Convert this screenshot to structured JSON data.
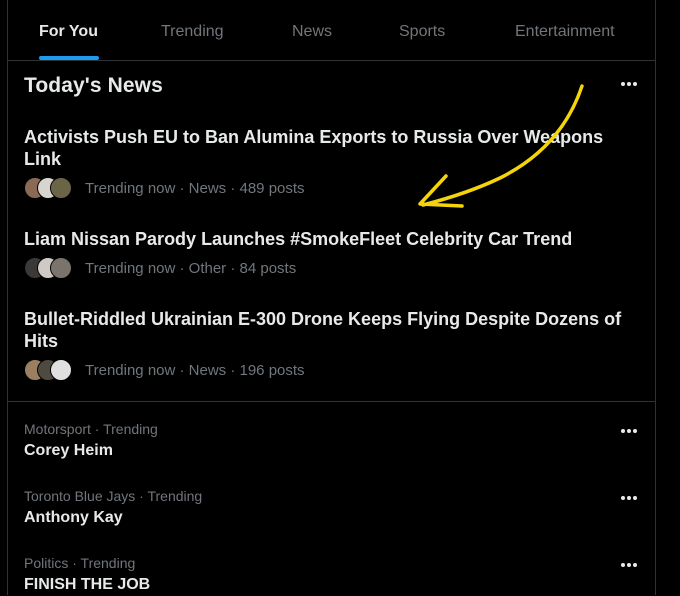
{
  "tabs": [
    {
      "label": "For You",
      "active": true
    },
    {
      "label": "Trending",
      "active": false
    },
    {
      "label": "News",
      "active": false
    },
    {
      "label": "Sports",
      "active": false
    },
    {
      "label": "Entertainment",
      "active": false
    }
  ],
  "section": {
    "title": "Today's News"
  },
  "news": [
    {
      "headline": "Activists Push EU to Ban Alumina Exports to Russia Over Weapons Link",
      "meta": "Trending now · News · 489 posts",
      "avatar_colors": [
        "#8a6a55",
        "#d8d4cf",
        "#6b6548"
      ]
    },
    {
      "headline": "Liam Nissan Parody Launches #SmokeFleet Celebrity Car Trend",
      "meta": "Trending now · Other · 84 posts",
      "avatar_colors": [
        "#3b3838",
        "#cfcac6",
        "#7a746c"
      ]
    },
    {
      "headline": "Bullet-Riddled Ukrainian E-300 Drone Keeps Flying Despite Dozens of Hits",
      "meta": "Trending now · News · 196 posts",
      "avatar_colors": [
        "#9a8060",
        "#4f4a40",
        "#e0e0e0"
      ]
    }
  ],
  "trends": [
    {
      "context": "Motorsport · Trending",
      "name": "Corey Heim"
    },
    {
      "context": "Toronto Blue Jays · Trending",
      "name": "Anthony Kay"
    },
    {
      "context": "Politics · Trending",
      "name": "FINISH THE JOB"
    }
  ],
  "colors": {
    "accent": "#1d9bf0",
    "annotation": "#f5d50a",
    "muted": "#71767b",
    "text": "#e7e9ea"
  },
  "icons": {
    "more": "more-horizontal-icon",
    "annotation": "arrow-annotation"
  }
}
